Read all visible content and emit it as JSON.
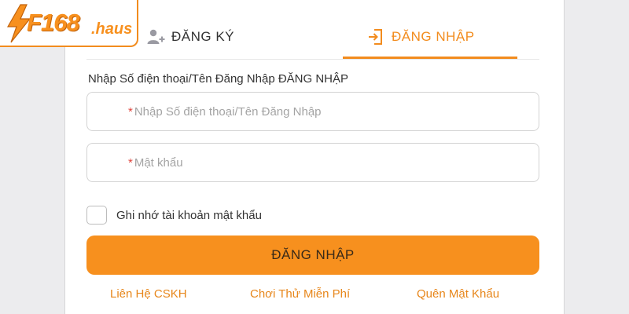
{
  "logo": {
    "main": "F168",
    "sub": ".haus"
  },
  "tabs": {
    "register_label": "ĐĂNG KÝ",
    "login_label": "ĐĂNG NHẬP"
  },
  "form": {
    "heading": "Nhập Số điện thoại/Tên Đăng Nhập ĐĂNG NHẬP",
    "username_placeholder": "Nhập Số điện thoại/Tên Đăng Nhập",
    "password_placeholder": "Mật khẩu",
    "required_mark": "*",
    "remember_label": "Ghi nhớ tài khoản mật khẩu",
    "submit_label": "ĐĂNG NHẬP"
  },
  "links": {
    "support": "Liên Hệ CSKH",
    "trial": "Chơi Thử Miễn Phí",
    "forgot": "Quên Mật Khẩu"
  },
  "colors": {
    "accent": "#f7901e",
    "accent_text": "#f28c1e",
    "required": "#e0443c",
    "border": "#d3d3d3",
    "page_bg": "#ececee"
  },
  "icons": {
    "register": "user-plus-icon",
    "login": "login-icon",
    "logo": "lightning-bolt-icon"
  },
  "state": {
    "active_tab": "login",
    "remember_checked": false
  }
}
